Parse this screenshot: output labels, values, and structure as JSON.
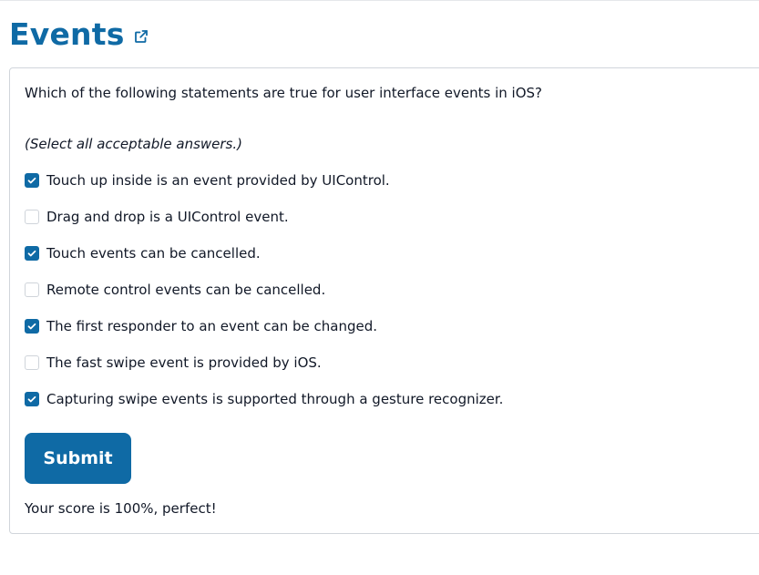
{
  "page": {
    "title": "Events",
    "external_link_icon": "external-link-icon"
  },
  "quiz": {
    "question": "Which of the following statements are true for user interface events in iOS?",
    "hint": "(Select all acceptable answers.)",
    "options": [
      {
        "label": "Touch up inside is an event provided by UIControl.",
        "checked": true
      },
      {
        "label": "Drag and drop is a UIControl event.",
        "checked": false
      },
      {
        "label": "Touch events can be cancelled.",
        "checked": true
      },
      {
        "label": "Remote control events can be cancelled.",
        "checked": false
      },
      {
        "label": "The first responder to an event can be changed.",
        "checked": true
      },
      {
        "label": "The fast swipe event is provided by iOS.",
        "checked": false
      },
      {
        "label": "Capturing swipe events is supported through a gesture recognizer.",
        "checked": true
      }
    ],
    "submit_label": "Submit",
    "score_text": "Your score is 100%, perfect!"
  },
  "colors": {
    "accent": "#0f6aa5",
    "text": "#111827",
    "border": "#d1d5db"
  }
}
